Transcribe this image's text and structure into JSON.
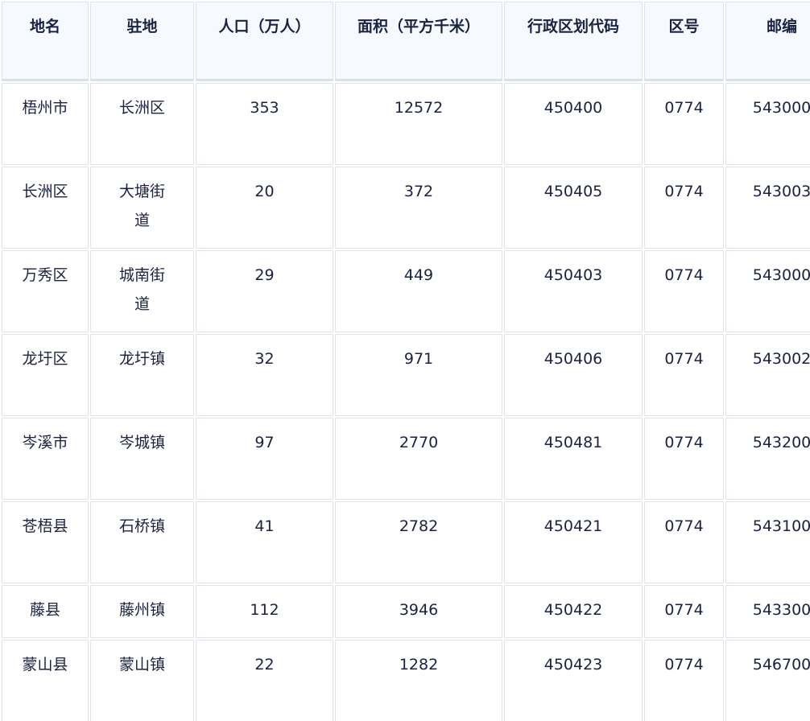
{
  "table": {
    "headers": [
      "地名",
      "驻地",
      "人口（万人）",
      "面积（平方千米）",
      "行政区划代码",
      "区号",
      "邮编"
    ],
    "rows": [
      [
        "梧州市",
        "长洲区",
        "353",
        "12572",
        "450400",
        "0774",
        "543000"
      ],
      [
        "长洲区",
        "大塘街道",
        "20",
        "372",
        "450405",
        "0774",
        "543003"
      ],
      [
        "万秀区",
        "城南街道",
        "29",
        "449",
        "450403",
        "0774",
        "543000"
      ],
      [
        "龙圩区",
        "龙圩镇",
        "32",
        "971",
        "450406",
        "0774",
        "543002"
      ],
      [
        "岑溪市",
        "岑城镇",
        "97",
        "2770",
        "450481",
        "0774",
        "543200"
      ],
      [
        "苍梧县",
        "石桥镇",
        "41",
        "2782",
        "450421",
        "0774",
        "543100"
      ],
      [
        "藤县",
        "藤州镇",
        "112",
        "3946",
        "450422",
        "0774",
        "543300"
      ],
      [
        "蒙山县",
        "蒙山镇",
        "22",
        "1282",
        "450423",
        "0774",
        "546700"
      ]
    ]
  }
}
